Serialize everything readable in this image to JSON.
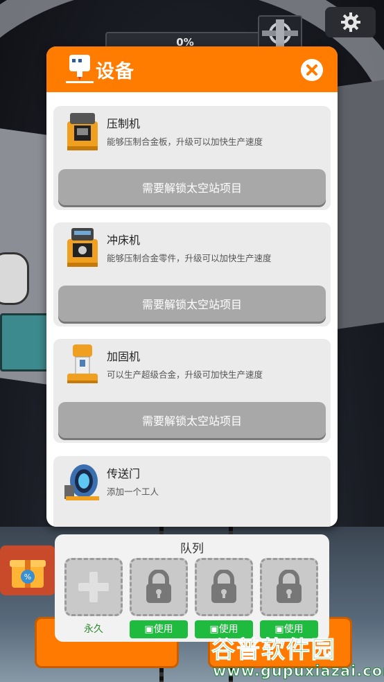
{
  "hud": {
    "progress_text": "0%",
    "progress_fraction": 0.0
  },
  "dialog": {
    "title": "设备",
    "items": [
      {
        "name": "压制机",
        "desc": "能够压制合金板，升级可以加快生产速度",
        "button": "需要解锁太空站项目",
        "icon": "press-machine-icon"
      },
      {
        "name": "冲床机",
        "desc": "能够压制合金零件，升级可以加快生产速度",
        "button": "需要解锁太空站项目",
        "icon": "punch-machine-icon"
      },
      {
        "name": "加固机",
        "desc": "可以生产超级合金，升级可加快生产速度",
        "button": "需要解锁太空站项目",
        "icon": "reinforce-machine-icon"
      },
      {
        "name": "传送门",
        "desc": "添加一个工人",
        "icon": "portal-icon"
      }
    ]
  },
  "queue": {
    "title": "队列",
    "slots": [
      {
        "state": "add",
        "label": "永久"
      },
      {
        "state": "locked",
        "label": "使用"
      },
      {
        "state": "locked",
        "label": "使用"
      },
      {
        "state": "locked",
        "label": "使用"
      }
    ]
  },
  "watermark": {
    "brand": "谷普软件园",
    "url": "www.gupuxiazai.com"
  },
  "colors": {
    "header_orange": "#ff7c00",
    "button_gray": "#a8a8a8",
    "use_green": "#1fbb3f",
    "card_bg": "#ebebeb"
  }
}
